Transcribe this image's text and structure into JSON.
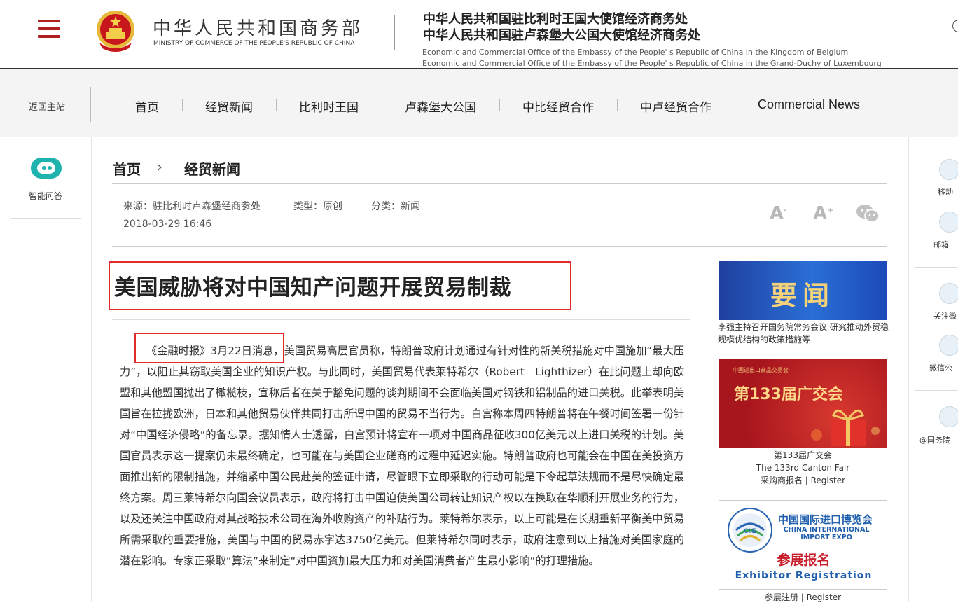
{
  "header": {
    "ministry_cn": "中华人民共和国商务部",
    "ministry_en": "MINISTRY OF COMMERCE OF THE PEOPLE'S REPUBLIC OF CHINA",
    "office_cn_1": "中华人民共和国驻比利时王国大使馆经济商务处",
    "office_cn_2": "中华人民共和国驻卢森堡大公国大使馆经济商务处",
    "office_en_1": "Economic and Commercial Office of the Embassy of the People' s Republic of China in the Kingdom of Belgium",
    "office_en_2": "Economic and Commercial Office of the Embassy of the People' s Republic of China in the Grand-Duchy of Luxembourg"
  },
  "nav": {
    "back": "返回主站",
    "items": [
      "首页",
      "经贸新闻",
      "比利时王国",
      "卢森堡大公国",
      "中比经贸合作",
      "中卢经贸合作",
      "Commercial News"
    ]
  },
  "left_sidebar": {
    "robot_label": "智能问答"
  },
  "breadcrumb": {
    "home": "首页",
    "arrow": "›",
    "current": "经贸新闻"
  },
  "meta": {
    "source": "来源：驻比利时卢森堡经商参处",
    "type": "类型：原创",
    "category": "分类：新闻",
    "date": "2018-03-29 16:46",
    "font_small": "A",
    "font_large": "A",
    "font_small_sup": "-",
    "font_large_sup": "+"
  },
  "article": {
    "title": "美国威胁将对中国知产问题开展贸易制裁",
    "source_line": "《金融时报》3月22日消息，",
    "body_first": "美国贸易高层官员称，特朗普政府计划通过有针对性的新关税措施对中国施加“最大压力”，以阻止其窃取美国企业的知识产权。与此同时，美国贸易代表莱特希尔（Robert　Lighthizer）在此问题上却向欧盟和其他盟国抛出了橄榄枝，宣称后者在关于豁免问题的谈判期间不会面临美国对钢铁和铝制品的进口关税。此举表明美国旨在拉拢欧洲，日本和其他贸易伙伴共同打击所谓中国的贸易不当行为。白宫称本周四特朗普将在午餐时间签署一份针对“中国经济侵略”的备忘录。据知情人士透露，白宫预计将宣布一项对中国商品征收300亿美元以上进口关税的计划。美国官员表示这一提案仍未最终确定，也可能在与美国企业磋商的过程中延迟实施。特朗普政府也可能会在中国在美投资方面推出新的限制措施，并缩紧中国公民赴美的签证申请，尽管眼下立即采取的行动可能是下令起草法规而不是尽快确定最终方案。周三莱特希尔向国会议员表示，政府将打击中国迫使美国公司转让知识产权以在换取在华顺利开展业务的行为，以及还关注中国政府对其战略技术公司在海外收购资产的补贴行为。莱特希尔表示，以上可能是在长期重新平衡美中贸易所需采取的重要措施，美国与中国的贸易赤字达3750亿美元。但莱特希尔同时表示，政府注意到以上措施对美国家庭的潜在影响。专家正采取“算法”来制定“对中国资加最大压力和对美国消费者产生最小影响”的打理措施。"
  },
  "right_column": {
    "card1_banner": "要闻",
    "card1_caption": "李强主持召开国务院常务会议 研究推动外贸稳规模优结构的政策措施等",
    "card2_small": "中国进出口商品交易会",
    "card2_banner": "第133届广交会",
    "card2_caption_1": "第133届广交会",
    "card2_caption_2": "The 133rd Canton Fair",
    "card2_caption_3": "采购商报名 | Register",
    "card3_cn": "中国国际进口博览会",
    "card3_en": "CHINA INTERNATIONAL IMPORT EXPO",
    "card3_logo": "CIIE",
    "card3_reg_cn": "参展报名",
    "card3_reg_en": "Exhibitor Registration",
    "card3_caption": "参展注册 | Register"
  },
  "right_sidebar": {
    "items": [
      "移动",
      "邮箱",
      "关注微",
      "微信公",
      "@国务院"
    ]
  },
  "colors": {
    "brand_red": "#b0201f",
    "highlight_red": "#e02b2b",
    "robot_teal": "#1fb3ad"
  }
}
